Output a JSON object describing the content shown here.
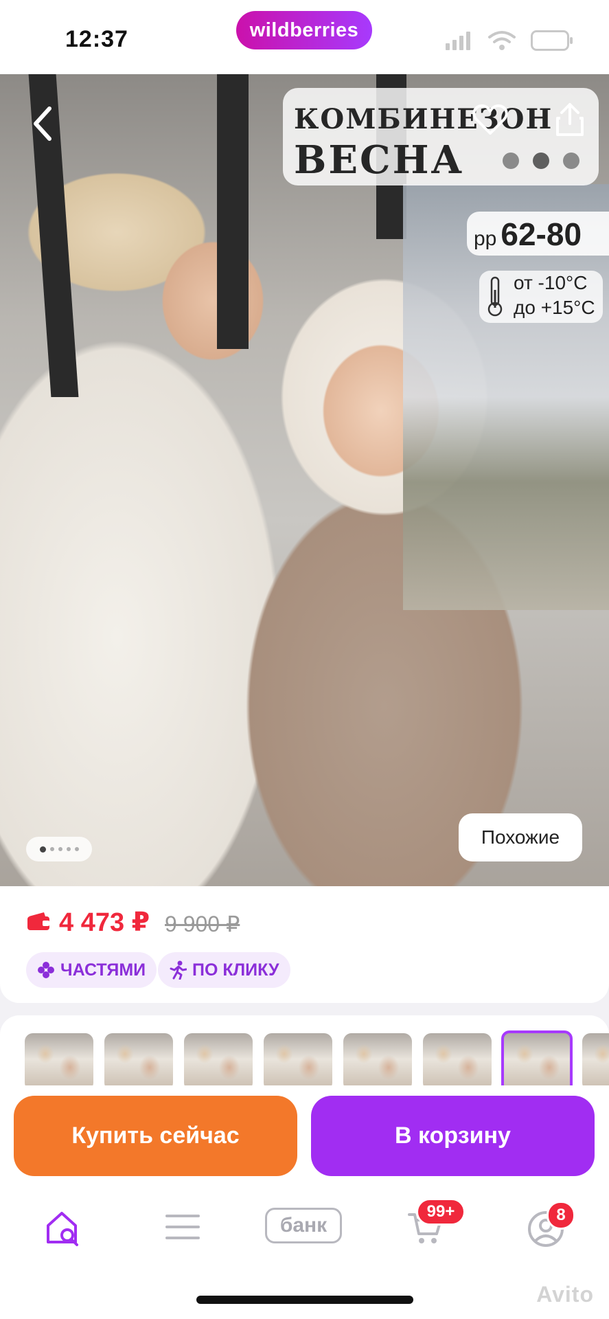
{
  "status_bar": {
    "time": "12:37",
    "brand": "wildberries"
  },
  "hero": {
    "title_line1": "КОМБИНЕЗОН",
    "title_line2": "ВЕСНА",
    "size_prefix": "рр",
    "size_range": "62-80",
    "temp_from": "от -10°C",
    "temp_to": "до +15°C",
    "similar_label": "Похожие"
  },
  "price": {
    "current": "4 473 ₽",
    "old": "9 900 ₽",
    "chips": [
      "ЧАСТЯМИ",
      "ПО КЛИКУ"
    ]
  },
  "actions": {
    "buy_now": "Купить сейчас",
    "add_to_cart": "В корзину"
  },
  "bottom_nav": {
    "bank_label": "банк",
    "cart_badge": "99+",
    "profile_badge": "8"
  },
  "watermark": "Avito",
  "colors": {
    "brand_gradient_start": "#cb11ab",
    "brand_gradient_end": "#a73afd",
    "price_red": "#f0283c",
    "buy_orange": "#f3782a",
    "cart_purple": "#a12df2"
  }
}
